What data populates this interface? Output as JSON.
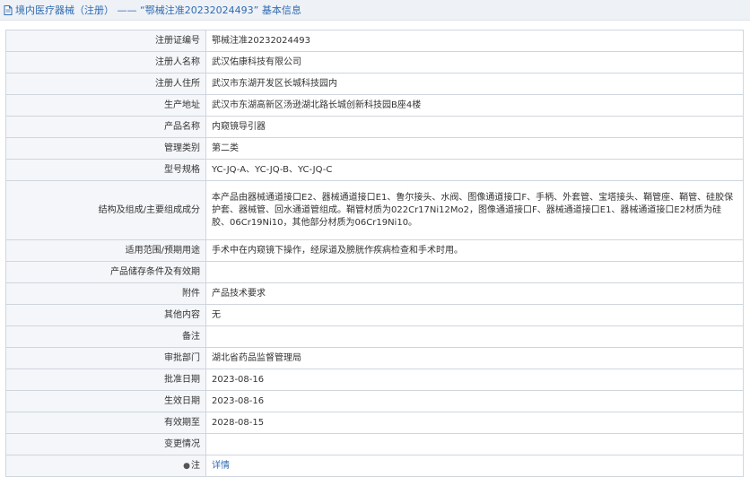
{
  "header": {
    "title": "境内医疗器械（注册） —— “鄂械注准20232024493” 基本信息"
  },
  "rows": [
    {
      "label": "注册证编号",
      "value": "鄂械注准20232024493"
    },
    {
      "label": "注册人名称",
      "value": "武汉佑康科技有限公司"
    },
    {
      "label": "注册人住所",
      "value": "武汉市东湖开发区长城科技园内"
    },
    {
      "label": "生产地址",
      "value": "武汉市东湖高新区汤逊湖北路长城创新科技园B座4楼"
    },
    {
      "label": "产品名称",
      "value": "内窥镜导引器"
    },
    {
      "label": "管理类别",
      "value": "第二类"
    },
    {
      "label": "型号规格",
      "value": "YC-JQ-A、YC-JQ-B、YC-JQ-C"
    },
    {
      "label": "结构及组成/主要组成成分",
      "value": "本产品由器械通道接口E2、器械通道接口E1、鲁尔接头、水阀、图像通道接口F、手柄、外套管、宝塔接头、鞘管座、鞘管、硅胶保护套、器械管、回水通道管组成。鞘管材质为022Cr17Ni12Mo2，图像通道接口F、器械通道接口E1、器械通道接口E2材质为硅胶、06Cr19Ni10，其他部分材质为06Cr19Ni10。"
    },
    {
      "label": "适用范围/预期用途",
      "value": "手术中在内窥镜下操作，经尿道及膀胱作疾病检查和手术时用。"
    },
    {
      "label": "产品储存条件及有效期",
      "value": ""
    },
    {
      "label": "附件",
      "value": "产品技术要求"
    },
    {
      "label": "其他内容",
      "value": "无"
    },
    {
      "label": "备注",
      "value": ""
    },
    {
      "label": "审批部门",
      "value": "湖北省药品监督管理局"
    },
    {
      "label": "批准日期",
      "value": "2023-08-16"
    },
    {
      "label": "生效日期",
      "value": "2023-08-16"
    },
    {
      "label": "有效期至",
      "value": "2028-08-15"
    },
    {
      "label": "变更情况",
      "value": ""
    }
  ],
  "note_row": {
    "icon": "pin-icon",
    "label": "注",
    "link_text": "详情"
  }
}
